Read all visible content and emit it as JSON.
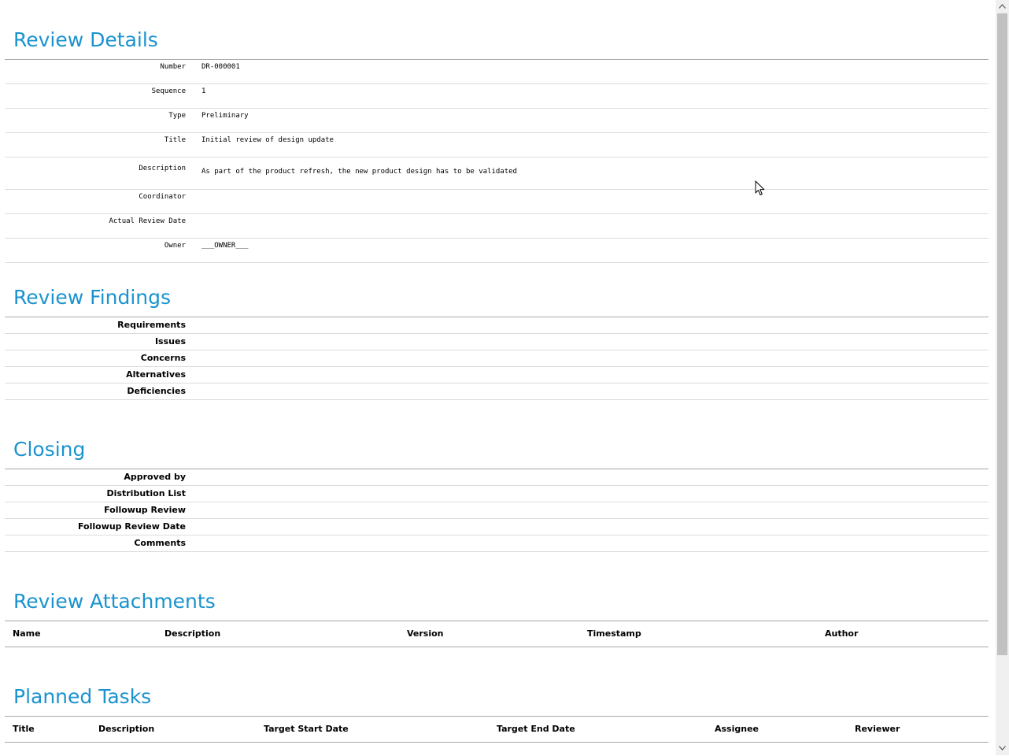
{
  "review_details": {
    "heading": "Review Details",
    "fields": [
      {
        "label": "Number",
        "value": "DR-000001"
      },
      {
        "label": "Sequence",
        "value": "1"
      },
      {
        "label": "Type",
        "value": "Preliminary"
      },
      {
        "label": "Title",
        "value": "Initial review of design update"
      },
      {
        "label": "Description",
        "value": "As part of the product refresh, the new product design has to be validated"
      },
      {
        "label": "Coordinator",
        "value": ""
      },
      {
        "label": "Actual Review Date",
        "value": ""
      },
      {
        "label": "Owner",
        "value": "___OWNER___"
      }
    ]
  },
  "review_findings": {
    "heading": "Review Findings",
    "fields": [
      "Requirements",
      "Issues",
      "Concerns",
      "Alternatives",
      "Deficiencies"
    ]
  },
  "closing": {
    "heading": "Closing",
    "fields": [
      "Approved by",
      "Distribution List",
      "Followup Review",
      "Followup Review Date",
      "Comments"
    ]
  },
  "review_attachments": {
    "heading": "Review Attachments",
    "columns": [
      "Name",
      "Description",
      "Version",
      "Timestamp",
      "Author"
    ]
  },
  "planned_tasks": {
    "heading": "Planned Tasks",
    "columns": [
      "Title",
      "Description",
      "Target Start Date",
      "Target End Date",
      "Assignee",
      "Reviewer"
    ]
  },
  "icons": {
    "scroll_up": "chevron-up-icon",
    "scroll_down": "chevron-down-icon",
    "cursor": "mouse-pointer-icon"
  }
}
